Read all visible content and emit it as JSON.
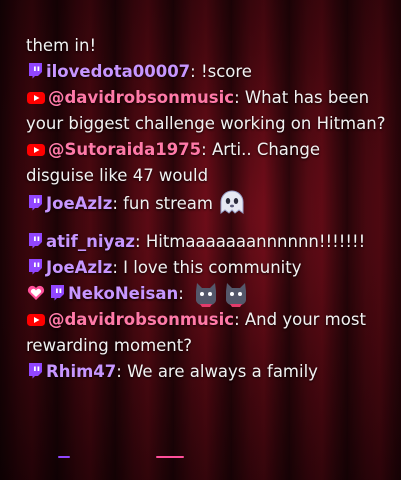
{
  "colors": {
    "twitch": "#9146ff",
    "youtube": "#ff0000",
    "twitch_user": "#c796ff",
    "youtube_user": "#ff7aa8",
    "text": "#f2f2f2",
    "heart": "#ff4f9a"
  },
  "messages": [
    {
      "platform": null,
      "user": "",
      "text": "them in!"
    },
    {
      "platform": "twitch",
      "icon": "twitch-icon",
      "user": "ilovedota00007",
      "sep": ":",
      "text": " !score"
    },
    {
      "platform": "youtube",
      "icon": "youtube-icon",
      "user": "@davidrobsonmusic",
      "sep": ":",
      "text": " What has been your biggest challenge working on Hitman?"
    },
    {
      "platform": "youtube",
      "icon": "youtube-icon",
      "user": "@Sutoraida1975",
      "sep": ":",
      "text": " Arti.. Change disguise like 47 would"
    },
    {
      "platform": "twitch",
      "icon": "twitch-icon",
      "user": "JoeAzlz",
      "sep": ":",
      "text": " fun stream",
      "emote": "ghost-emote"
    },
    {
      "platform": "twitch",
      "icon": "twitch-icon",
      "user": "atif_niyaz",
      "sep": ":",
      "text": " Hitmaaaaaaannnnnn!!!!!!!"
    },
    {
      "platform": "twitch",
      "icon": "twitch-icon",
      "user": "JoeAzlz",
      "sep": ":",
      "text": " I love this community"
    },
    {
      "platform": "twitch",
      "icon": "twitch-icon",
      "badge": "heart-badge-icon",
      "user": "NekoNeisan",
      "sep": ":",
      "text": " ",
      "emote": "cat-emote",
      "emote_count": 2
    },
    {
      "platform": "youtube",
      "icon": "youtube-icon",
      "user": "@davidrobsonmusic",
      "sep": ":",
      "text": " And your most rewarding moment?"
    },
    {
      "platform": "twitch",
      "icon": "twitch-icon",
      "user": "Rhim47",
      "sep": ":",
      "text": " We are always a family"
    }
  ]
}
